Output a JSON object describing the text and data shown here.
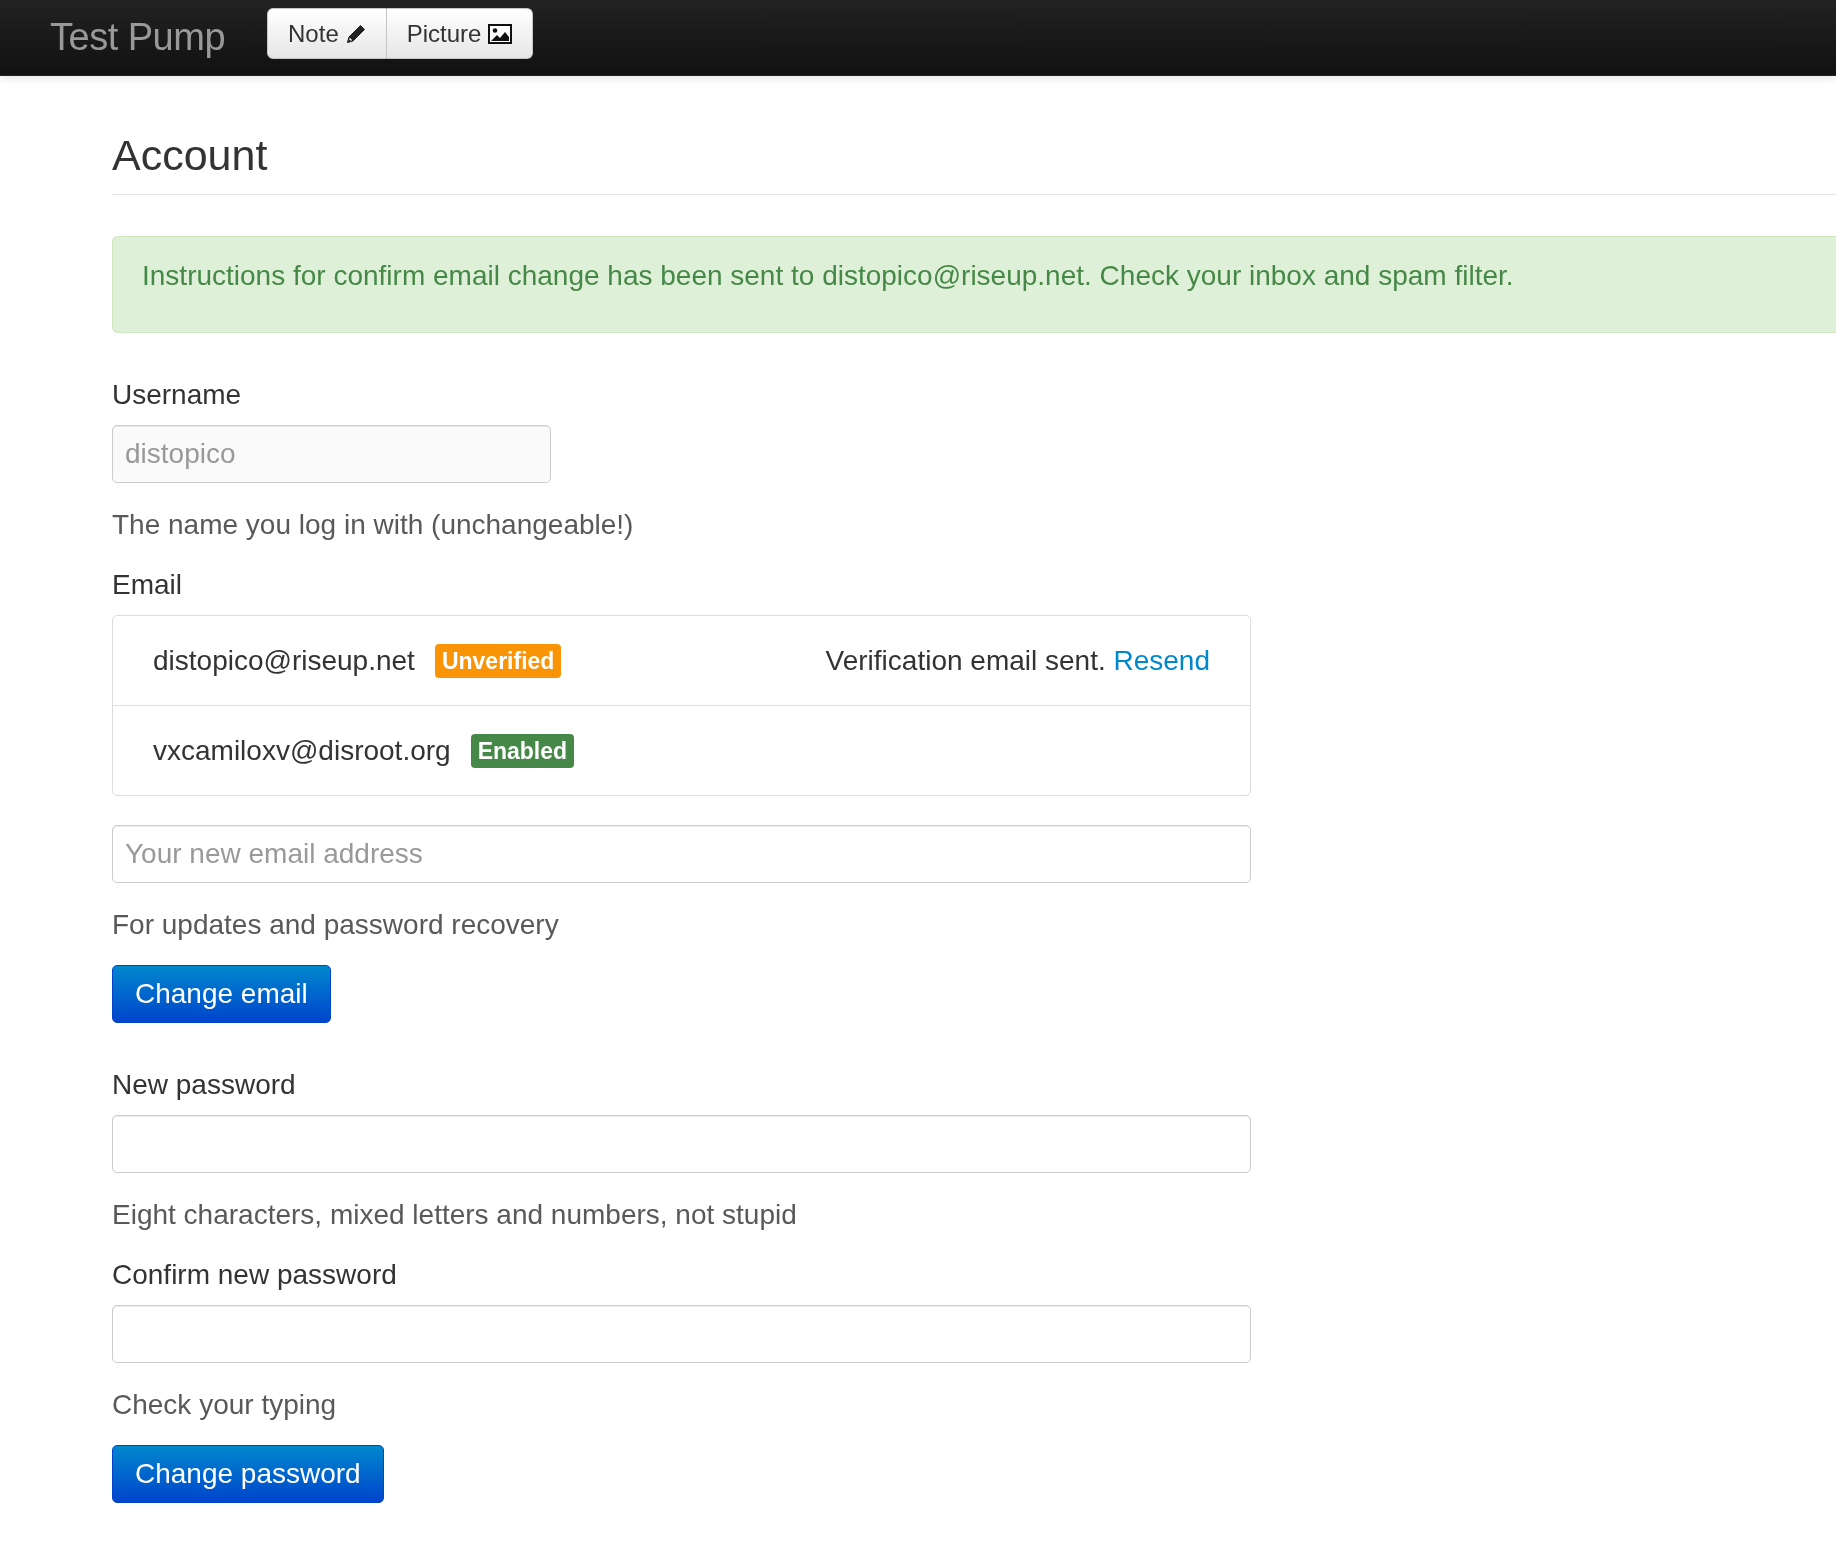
{
  "navbar": {
    "brand": "Test Pump",
    "buttons": [
      {
        "label": "Note",
        "kind": "note"
      },
      {
        "label": "Picture",
        "kind": "picture"
      }
    ]
  },
  "account": {
    "title": "Account",
    "alert": "Instructions for confirm email change has been sent to distopico@riseup.net. Check your inbox and spam filter.",
    "username": {
      "label": "Username",
      "value": "distopico",
      "disabled": true,
      "help": "The name you log in with (unchangeable!)"
    },
    "email": {
      "label": "Email",
      "addresses": [
        {
          "address": "distopico@riseup.net",
          "status": "Unverified",
          "color": "#f89406",
          "note": "Verification email sent.",
          "link": "Resend"
        },
        {
          "address": "vxcamiloxv@disroot.org",
          "status": "Enabled",
          "color": "#468847"
        }
      ],
      "new_email": {
        "placeholder": "Your new email address"
      },
      "help": "For updates and password recovery",
      "button": "Change email"
    },
    "password": {
      "label": "New password",
      "help": "Eight characters, mixed letters and numbers, not stupid"
    },
    "confirm": {
      "label": "Confirm new password",
      "help": "Check your typing"
    },
    "password_button": "Change password"
  }
}
